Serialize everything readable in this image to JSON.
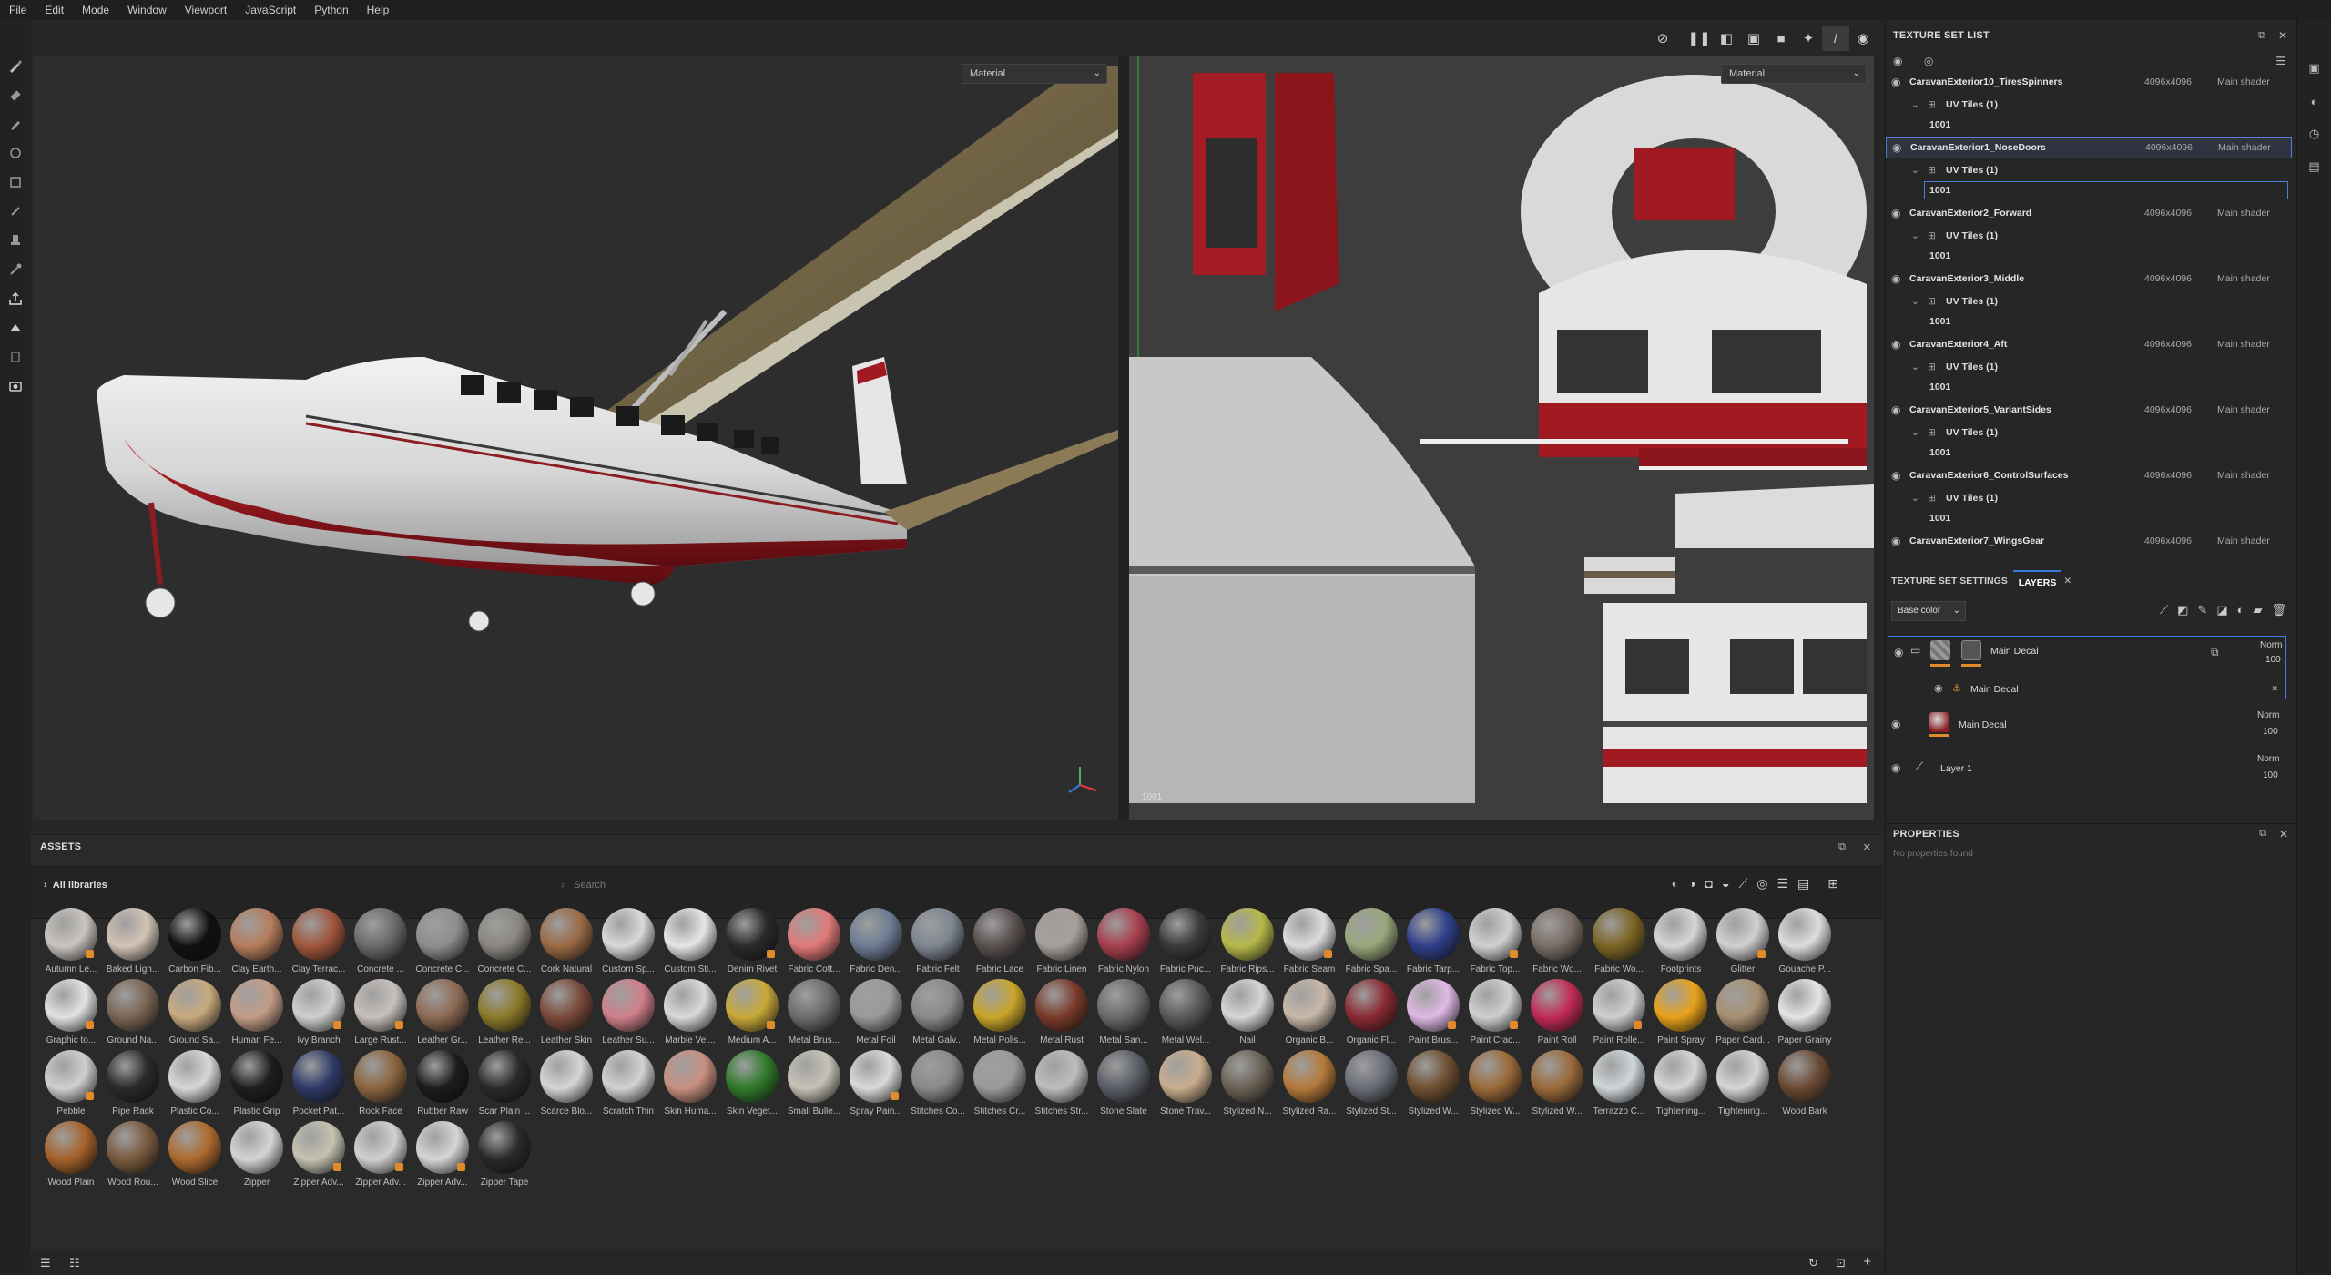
{
  "menu": [
    "File",
    "Edit",
    "Mode",
    "Window",
    "Viewport",
    "JavaScript",
    "Python",
    "Help"
  ],
  "viewport3d": {
    "mode": "Material"
  },
  "viewport2d": {
    "mode": "Material",
    "tile": "1001"
  },
  "assets": {
    "title": "ASSETS",
    "library": "All libraries",
    "search_placeholder": "Search",
    "items": [
      {
        "label": "Autumn Le...",
        "color": "#c9c4bf",
        "mark": "#e08a2a"
      },
      {
        "label": "Baked Ligh...",
        "color": "#d2c3b5",
        "mark": ""
      },
      {
        "label": "Carbon Fib...",
        "color": "#111111",
        "mark": ""
      },
      {
        "label": "Clay Earth...",
        "color": "#b57d5d",
        "mark": ""
      },
      {
        "label": "Clay Terrac...",
        "color": "#a1563e",
        "mark": ""
      },
      {
        "label": "Concrete ...",
        "color": "#6a6a6a",
        "mark": ""
      },
      {
        "label": "Concrete C...",
        "color": "#8e8e8e",
        "mark": ""
      },
      {
        "label": "Concrete C...",
        "color": "#8a8780",
        "mark": ""
      },
      {
        "label": "Cork Natural",
        "color": "#9a6a45",
        "mark": ""
      },
      {
        "label": "Custom Sp...",
        "color": "#d9d9d9",
        "mark": ""
      },
      {
        "label": "Custom Sti...",
        "color": "#e6e6e6",
        "mark": ""
      },
      {
        "label": "Denim Rivet",
        "color": "#2a2a2a",
        "mark": "#e08a2a"
      },
      {
        "label": "Fabric Cott...",
        "color": "#e07a78",
        "mark": ""
      },
      {
        "label": "Fabric Den...",
        "color": "#6d7c93",
        "mark": ""
      },
      {
        "label": "Fabric Felt",
        "color": "#7e8691",
        "mark": ""
      },
      {
        "label": "Fabric Lace",
        "color": "#5a5050",
        "mark": ""
      },
      {
        "label": "Fabric Linen",
        "color": "#a79f9a",
        "mark": ""
      },
      {
        "label": "Fabric Nylon",
        "color": "#a7404e",
        "mark": ""
      },
      {
        "label": "Fabric Puc...",
        "color": "#3a3a3a",
        "mark": ""
      },
      {
        "label": "Fabric Rips...",
        "color": "#b7b84a",
        "mark": ""
      },
      {
        "label": "Fabric Seam",
        "color": "#dcdcdc",
        "mark": "#e08a2a"
      },
      {
        "label": "Fabric Spa...",
        "color": "#99a77c",
        "mark": ""
      },
      {
        "label": "Fabric Tarp...",
        "color": "#2f3f8a",
        "mark": ""
      },
      {
        "label": "Fabric Top...",
        "color": "#d0d0d0",
        "mark": "#e08a2a"
      },
      {
        "label": "Fabric Wo...",
        "color": "#7a6e66",
        "mark": ""
      },
      {
        "label": "Fabric Wo...",
        "color": "#7c6524",
        "mark": ""
      },
      {
        "label": "Footprints",
        "color": "#d6d6d6",
        "mark": ""
      },
      {
        "label": "Glitter",
        "color": "#d0d0d0",
        "mark": "#e08a2a"
      },
      {
        "label": "Gouache P...",
        "color": "#dddddd",
        "mark": ""
      },
      {
        "label": "Graphic to...",
        "color": "#e2e2e2",
        "mark": "#e08a2a"
      },
      {
        "label": "Ground Na...",
        "color": "#7a6553",
        "mark": ""
      },
      {
        "label": "Ground Sa...",
        "color": "#c8aa7d",
        "mark": ""
      },
      {
        "label": "Human Fe...",
        "color": "#c39c86",
        "mark": ""
      },
      {
        "label": "Ivy Branch",
        "color": "#cfcfcf",
        "mark": "#e08a2a"
      },
      {
        "label": "Large Rust...",
        "color": "#c8c0bc",
        "mark": "#e08a2a"
      },
      {
        "label": "Leather Gr...",
        "color": "#8d6a54",
        "mark": ""
      },
      {
        "label": "Leather Re...",
        "color": "#8c7a2a",
        "mark": ""
      },
      {
        "label": "Leather Skin",
        "color": "#7a4a3a",
        "mark": ""
      },
      {
        "label": "Leather Su...",
        "color": "#cf7f8a",
        "mark": ""
      },
      {
        "label": "Marble Vei...",
        "color": "#d9d9d9",
        "mark": ""
      },
      {
        "label": "Medium A...",
        "color": "#c9a938",
        "mark": "#e08a2a"
      },
      {
        "label": "Metal Brus...",
        "color": "#6c6c6c",
        "mark": ""
      },
      {
        "label": "Metal Foil",
        "color": "#9a9a9a",
        "mark": ""
      },
      {
        "label": "Metal Galv...",
        "color": "#8a8a8a",
        "mark": ""
      },
      {
        "label": "Metal Polis...",
        "color": "#c9a52a",
        "mark": ""
      },
      {
        "label": "Metal Rust",
        "color": "#7a3a2a",
        "mark": ""
      },
      {
        "label": "Metal San...",
        "color": "#6a6a6a",
        "mark": ""
      },
      {
        "label": "Metal Wel...",
        "color": "#5a5a5a",
        "mark": ""
      },
      {
        "label": "Nail",
        "color": "#d5d5d5",
        "mark": ""
      },
      {
        "label": "Organic B...",
        "color": "#c8b8a8",
        "mark": ""
      },
      {
        "label": "Organic Fl...",
        "color": "#8a2a33",
        "mark": ""
      },
      {
        "label": "Paint Brus...",
        "color": "#e0b9e5",
        "mark": "#e08a2a"
      },
      {
        "label": "Paint Crac...",
        "color": "#cfcfcf",
        "mark": "#e08a2a"
      },
      {
        "label": "Paint Roll",
        "color": "#c22a55",
        "mark": ""
      },
      {
        "label": "Paint Rolle...",
        "color": "#cfcfcf",
        "mark": "#e08a2a"
      },
      {
        "label": "Paint Spray",
        "color": "#e8a21a",
        "mark": ""
      },
      {
        "label": "Paper Card...",
        "color": "#a89072",
        "mark": ""
      },
      {
        "label": "Paper Grainy",
        "color": "#e5e5e5",
        "mark": ""
      },
      {
        "label": "Pebble",
        "color": "#cfcfcf",
        "mark": "#e08a2a"
      },
      {
        "label": "Pipe Rack",
        "color": "#2a2a2a",
        "mark": ""
      },
      {
        "label": "Plastic Co...",
        "color": "#d7d7d7",
        "mark": ""
      },
      {
        "label": "Plastic Grip",
        "color": "#1e1e1e",
        "mark": ""
      },
      {
        "label": "Pocket Pat...",
        "color": "#2e3a66",
        "mark": ""
      },
      {
        "label": "Rock Face",
        "color": "#8a6540",
        "mark": ""
      },
      {
        "label": "Rubber Raw",
        "color": "#1c1c1c",
        "mark": ""
      },
      {
        "label": "Scar Plain ...",
        "color": "#2a2a2a",
        "mark": ""
      },
      {
        "label": "Scarce Blo...",
        "color": "#d5d5d5",
        "mark": ""
      },
      {
        "label": "Scratch Thin",
        "color": "#d2d2d2",
        "mark": ""
      },
      {
        "label": "Skin Huma...",
        "color": "#c89080",
        "mark": ""
      },
      {
        "label": "Skin Veget...",
        "color": "#2f7a2a",
        "mark": ""
      },
      {
        "label": "Small Bulle...",
        "color": "#c7c2b7",
        "mark": ""
      },
      {
        "label": "Spray Pain...",
        "color": "#d9d9d9",
        "mark": "#e08a2a"
      },
      {
        "label": "Stitches Co...",
        "color": "#8a8a8a",
        "mark": ""
      },
      {
        "label": "Stitches Cr...",
        "color": "#9a9a9a",
        "mark": ""
      },
      {
        "label": "Stitches Str...",
        "color": "#bdbdbd",
        "mark": ""
      },
      {
        "label": "Stone Slate",
        "color": "#5a5e66",
        "mark": ""
      },
      {
        "label": "Stone Trav...",
        "color": "#c9ad8e",
        "mark": ""
      },
      {
        "label": "Stylized N...",
        "color": "#6a6255",
        "mark": ""
      },
      {
        "label": "Stylized Ra...",
        "color": "#b47a3a",
        "mark": ""
      },
      {
        "label": "Stylized St...",
        "color": "#6a6d78",
        "mark": ""
      },
      {
        "label": "Stylized W...",
        "color": "#6e5032",
        "mark": ""
      },
      {
        "label": "Stylized W...",
        "color": "#9a6a3a",
        "mark": ""
      },
      {
        "label": "Stylized W...",
        "color": "#9a6a3a",
        "mark": ""
      },
      {
        "label": "Terrazzo C...",
        "color": "#cfd6da",
        "mark": ""
      },
      {
        "label": "Tightening...",
        "color": "#d5d5d5",
        "mark": ""
      },
      {
        "label": "Tightening...",
        "color": "#d5d5d5",
        "mark": ""
      },
      {
        "label": "Wood Bark",
        "color": "#6a4a33",
        "mark": ""
      },
      {
        "label": "Wood Plain",
        "color": "#a5612a",
        "mark": ""
      },
      {
        "label": "Wood Rou...",
        "color": "#7a5a3e",
        "mark": ""
      },
      {
        "label": "Wood Slice",
        "color": "#ad6a2e",
        "mark": ""
      },
      {
        "label": "Zipper",
        "color": "#d5d5d5",
        "mark": ""
      },
      {
        "label": "Zipper Adv...",
        "color": "#c5c2b0",
        "mark": "#e08a2a"
      },
      {
        "label": "Zipper Adv...",
        "color": "#d0d0d0",
        "mark": "#e08a2a"
      },
      {
        "label": "Zipper Adv...",
        "color": "#d5d5d5",
        "mark": "#e08a2a"
      },
      {
        "label": "Zipper Tape",
        "color": "#2a2a2a",
        "mark": ""
      }
    ]
  },
  "texture_set_list": {
    "title": "TEXTURE SET LIST",
    "sets": [
      {
        "name": "CaravanExterior10_TiresSpinners",
        "res": "4096x4096",
        "shader": "Main shader",
        "uv": "UV Tiles (1)",
        "tile": "1001"
      },
      {
        "name": "CaravanExterior1_NoseDoors",
        "res": "4096x4096",
        "shader": "Main shader",
        "uv": "UV Tiles (1)",
        "tile": "1001"
      },
      {
        "name": "CaravanExterior2_Forward",
        "res": "4096x4096",
        "shader": "Main shader",
        "uv": "UV Tiles (1)",
        "tile": "1001"
      },
      {
        "name": "CaravanExterior3_Middle",
        "res": "4096x4096",
        "shader": "Main shader",
        "uv": "UV Tiles (1)",
        "tile": "1001"
      },
      {
        "name": "CaravanExterior4_Aft",
        "res": "4096x4096",
        "shader": "Main shader",
        "uv": "UV Tiles (1)",
        "tile": "1001"
      },
      {
        "name": "CaravanExterior5_VariantSides",
        "res": "4096x4096",
        "shader": "Main shader",
        "uv": "UV Tiles (1)",
        "tile": "1001"
      },
      {
        "name": "CaravanExterior6_ControlSurfaces",
        "res": "4096x4096",
        "shader": "Main shader",
        "uv": "UV Tiles (1)",
        "tile": "1001"
      },
      {
        "name": "CaravanExterior7_WingsGear",
        "res": "4096x4096",
        "shader": "Main shader",
        "uv": "",
        "tile": ""
      }
    ]
  },
  "layers": {
    "tab1": "TEXTURE SET SETTINGS",
    "tab2": "LAYERS",
    "channel": "Base color",
    "items": [
      {
        "name": "Main Decal",
        "blend": "Norm",
        "opacity": "100",
        "sub": "Main Decal"
      },
      {
        "name": "Main Decal",
        "blend": "Norm",
        "opacity": "100"
      },
      {
        "name": "Layer 1",
        "blend": "Norm",
        "opacity": "100"
      }
    ]
  },
  "properties": {
    "title": "PROPERTIES",
    "empty": "No properties found"
  }
}
